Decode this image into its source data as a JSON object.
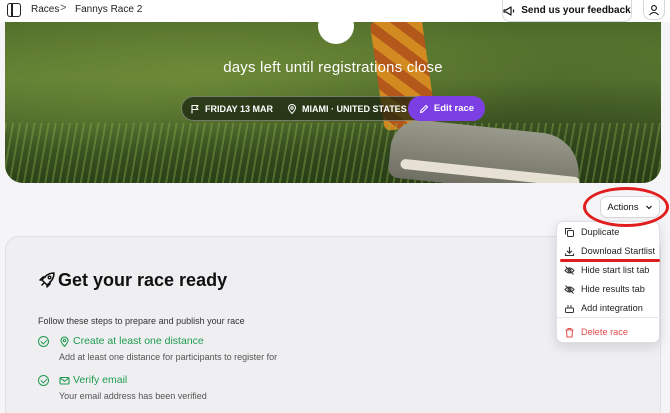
{
  "breadcrumb": {
    "root": "Races",
    "separator": ">",
    "current": "Fannys Race 2"
  },
  "header": {
    "feedback_label": "Send us your feedback"
  },
  "hero": {
    "countdown_text": "days left until registrations close",
    "date": "FRIDAY 13 MAR",
    "location": "MIAMI · UNITED STATES",
    "edit_label": "Edit race"
  },
  "actions": {
    "label": "Actions",
    "menu": [
      {
        "label": "Duplicate",
        "icon": "copy-icon"
      },
      {
        "label": "Download Startlist",
        "icon": "download-icon"
      },
      {
        "label": "Hide start list tab",
        "icon": "eye-off-icon"
      },
      {
        "label": "Hide results tab",
        "icon": "eye-off-icon"
      },
      {
        "label": "Add integration",
        "icon": "plug-icon"
      },
      {
        "label": "Delete race",
        "icon": "trash-icon",
        "danger": true
      }
    ]
  },
  "card": {
    "title": "Get your race ready",
    "subtitle": "Follow these steps to prepare and publish your race",
    "steps": [
      {
        "title": "Create at least one distance",
        "description": "Add at least one distance for participants to register for",
        "icon": "location-pin-icon"
      },
      {
        "title": "Verify email",
        "description": "Your email address has been verified",
        "icon": "mail-icon"
      }
    ]
  },
  "colors": {
    "accent": "#7b3fe4",
    "success": "#1f9a4f",
    "danger": "#e04a4a",
    "annotation": "#e11d1d"
  }
}
